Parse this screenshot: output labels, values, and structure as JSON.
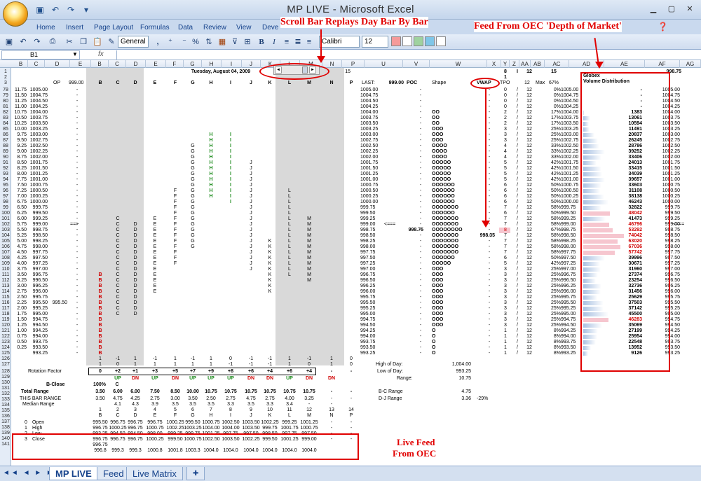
{
  "title": "MP LIVE - Microsoft Excel",
  "ribbon_tabs": [
    "Home",
    "Insert",
    "Page Layout",
    "Formulas",
    "Data",
    "Review",
    "View",
    "Deve"
  ],
  "font": {
    "style": "General",
    "face": "Calibri",
    "size": "12"
  },
  "namebox": "B1",
  "fx": "fx",
  "col_headers": [
    "B",
    "C",
    "D",
    "E",
    "B",
    "C",
    "D",
    "E",
    "F",
    "G",
    "H",
    "I",
    "J",
    "K",
    "L",
    "M",
    "N",
    "P",
    "U",
    "V",
    "W",
    "X",
    "Y",
    "Z",
    "AA",
    "AB",
    "AC",
    "AD",
    "AE",
    "AF",
    "AG"
  ],
  "header": {
    "r1_date": "Tuesday, August 04, 2009",
    "r1_15": "15",
    "r1_z": "8",
    "r1_aa": "I",
    "r1_ab": "12",
    "r1_ac": "15",
    "r1_af": "998.75",
    "r2_z": "1",
    "r3_op": "OP",
    "r3_999": "999.00",
    "r3_cols": [
      "B",
      "C",
      "D",
      "E",
      "F",
      "G",
      "H",
      "I",
      "J",
      "K",
      "L",
      "M",
      "N",
      "P"
    ],
    "r3_last": "LAST:",
    "r3_lastval": "999.00",
    "r3_poc": "POC",
    "r3_shape": "Shape",
    "r3_vwap": "VWAP",
    "r3_tpo": "TPO",
    "r3_12": "12",
    "r3_max": "Max",
    "r3_67": "67%",
    "ae_title1": "Globex",
    "ae_title2": "Volume Distribution"
  },
  "rows": [
    {
      "r": "78",
      "b": "11.75",
      "c": "1005.00",
      "u": "1005.00",
      "tpo": "0",
      "pct": "0%",
      "ad": "1005.00",
      "vol": "-",
      "af": "1005.00"
    },
    {
      "r": "79",
      "b": "11.50",
      "c": "1004.75",
      "u": "1004.75",
      "tpo": "0",
      "pct": "0%",
      "ad": "1004.75",
      "vol": "-",
      "af": "1004.75"
    },
    {
      "r": "80",
      "b": "11.25",
      "c": "1004.50",
      "u": "1004.50",
      "tpo": "0",
      "pct": "0%",
      "ad": "1004.50",
      "vol": "-",
      "af": "1004.50"
    },
    {
      "r": "81",
      "b": "11.00",
      "c": "1004.25",
      "u": "1004.25",
      "tpo": "0",
      "pct": "0%",
      "ad": "1004.25",
      "vol": "-",
      "af": "1004.25"
    },
    {
      "r": "82",
      "b": "10.75",
      "c": "1004.00",
      "u": "1004.00",
      "sh": "OO",
      "tpo": "2",
      "pct": "17%",
      "ad": "1004.00",
      "vol": "1383",
      "af": "1004.00"
    },
    {
      "r": "83",
      "b": "10.50",
      "c": "1003.75",
      "u": "1003.75",
      "sh": "OO",
      "tpo": "2",
      "pct": "17%",
      "ad": "1003.75",
      "vol": "13061",
      "af": "1003.75"
    },
    {
      "r": "84",
      "b": "10.25",
      "c": "1003.50",
      "u": "1003.50",
      "sh": "OO",
      "tpo": "2",
      "pct": "17%",
      "ad": "1003.50",
      "vol": "10594",
      "af": "1003.50"
    },
    {
      "r": "85",
      "b": "10.00",
      "c": "1003.25",
      "u": "1003.25",
      "sh": "OOO",
      "tpo": "3",
      "pct": "25%",
      "ad": "1003.25",
      "vol": "11491",
      "af": "1003.25"
    },
    {
      "r": "86",
      "b": "9.75",
      "c": "1003.00",
      "u": "1003.00",
      "sh": "OOO",
      "tpo": "3",
      "pct": "25%",
      "ad": "1003.00",
      "vol": "20837",
      "af": "1003.00"
    },
    {
      "r": "87",
      "b": "9.50",
      "c": "1002.75",
      "u": "1002.75",
      "sh": "OOO",
      "tpo": "3",
      "pct": "25%",
      "ad": "1002.75",
      "vol": "26245",
      "af": "1002.75"
    },
    {
      "r": "88",
      "b": "9.25",
      "c": "1002.50",
      "u": "1002.50",
      "sh": "OOOO",
      "tpo": "4",
      "pct": "33%",
      "ad": "1002.50",
      "vol": "28786",
      "af": "1002.50"
    },
    {
      "r": "89",
      "b": "9.00",
      "c": "1002.25",
      "u": "1002.25",
      "sh": "OOOO",
      "tpo": "4",
      "pct": "33%",
      "ad": "1002.25",
      "vol": "39252",
      "af": "1002.25"
    },
    {
      "r": "90",
      "b": "8.75",
      "c": "1002.00",
      "u": "1002.00",
      "sh": "OOOO",
      "tpo": "4",
      "pct": "33%",
      "ad": "1002.00",
      "vol": "33406",
      "af": "1002.00"
    },
    {
      "r": "91",
      "b": "8.50",
      "c": "1001.75",
      "u": "1001.75",
      "sh": "OOOOO",
      "tpo": "5",
      "pct": "42%",
      "ad": "1001.75",
      "vol": "24013",
      "af": "1001.75"
    },
    {
      "r": "92",
      "b": "8.25",
      "c": "1001.50",
      "u": "1001.50",
      "sh": "OOOOO",
      "tpo": "5",
      "pct": "42%",
      "ad": "1001.50",
      "vol": "33415",
      "af": "1001.50"
    },
    {
      "r": "93",
      "b": "8.00",
      "c": "1001.25",
      "u": "1001.25",
      "sh": "OOOOO",
      "tpo": "5",
      "pct": "42%",
      "ad": "1001.25",
      "vol": "34039",
      "af": "1001.25"
    },
    {
      "r": "94",
      "b": "7.75",
      "c": "1001.00",
      "u": "1001.00",
      "sh": "OOOOO",
      "tpo": "5",
      "pct": "42%",
      "ad": "1001.00",
      "vol": "39657",
      "af": "1001.00"
    },
    {
      "r": "95",
      "b": "7.50",
      "c": "1000.75",
      "u": "1000.75",
      "sh": "OOOOOO",
      "tpo": "6",
      "pct": "50%",
      "ad": "1000.75",
      "vol": "33603",
      "af": "1000.75"
    },
    {
      "r": "96",
      "b": "7.25",
      "c": "1000.50",
      "u": "1000.50",
      "sh": "OOOOOO",
      "tpo": "6",
      "pct": "50%",
      "ad": "1000.50",
      "vol": "31108",
      "af": "1000.50"
    },
    {
      "r": "97",
      "b": "7.00",
      "c": "1000.25",
      "u": "1000.25",
      "sh": "OOOOOO",
      "tpo": "6",
      "pct": "50%",
      "ad": "1000.25",
      "vol": "38138",
      "af": "1000.25"
    },
    {
      "r": "98",
      "b": "6.75",
      "c": "1000.00",
      "u": "1000.00",
      "sh": "OOOOOO",
      "tpo": "6",
      "pct": "50%",
      "ad": "1000.00",
      "vol": "46243",
      "af": "1000.00"
    },
    {
      "r": "99",
      "b": "6.50",
      "c": "999.75",
      "u": "999.75",
      "sh": "OOOOOOO",
      "tpo": "7",
      "pct": "58%",
      "ad": "999.75",
      "vol": "32822",
      "af": "999.75"
    },
    {
      "r": "100",
      "b": "6.25",
      "c": "999.50",
      "u": "999.50",
      "sh": "OOOOOO",
      "tpo": "6",
      "pct": "50%",
      "ad": "999.50",
      "vol": "48042",
      "af": "999.50",
      "hi": true
    },
    {
      "r": "101",
      "b": "6.00",
      "c": "999.25",
      "u": "999.25",
      "sh": "OOOOOOO",
      "tpo": "7",
      "pct": "58%",
      "ad": "999.25",
      "vol": "41473",
      "af": "999.25"
    },
    {
      "r": "102",
      "b": "5.75",
      "c": "999.00",
      "u": "999.00",
      "sh": "OOOOOOO",
      "tpo": "7",
      "pct": "58%",
      "ad": "999.00",
      "vol": "46796",
      "af": "999.00",
      "hi": true
    },
    {
      "r": "103",
      "b": "5.50",
      "c": "998.75",
      "u": "998.75",
      "sh": "OOOOOOOO",
      "tpo": "8",
      "pct": "67%",
      "ad": "998.75",
      "vol": "53292",
      "af": "998.75",
      "hi": true,
      "poc": true
    },
    {
      "r": "104",
      "b": "5.25",
      "c": "998.50",
      "u": "998.50",
      "sh": "OOOOOOO",
      "tpo": "7",
      "pct": "58%",
      "ad": "998.50",
      "vol": "74042",
      "af": "998.50",
      "hi": true
    },
    {
      "r": "105",
      "b": "5.00",
      "c": "998.25",
      "u": "998.25",
      "sh": "OOOOOOO",
      "tpo": "7",
      "pct": "58%",
      "ad": "998.25",
      "vol": "63020",
      "af": "998.25",
      "hi": true
    },
    {
      "r": "106",
      "b": "4.75",
      "c": "998.00",
      "u": "998.00",
      "sh": "OOOOOOO",
      "tpo": "7",
      "pct": "58%",
      "ad": "998.00",
      "vol": "67036",
      "af": "998.00",
      "hi": true
    },
    {
      "r": "107",
      "b": "4.50",
      "c": "997.75",
      "u": "997.75",
      "sh": "OOOOOOO",
      "tpo": "7",
      "pct": "58%",
      "ad": "997.75",
      "vol": "57742",
      "af": "997.75",
      "hi": true
    },
    {
      "r": "108",
      "b": "4.25",
      "c": "997.50",
      "u": "997.50",
      "sh": "OOOOOO",
      "tpo": "6",
      "pct": "50%",
      "ad": "997.50",
      "vol": "39996",
      "af": "997.50"
    },
    {
      "r": "109",
      "b": "4.00",
      "c": "997.25",
      "u": "997.25",
      "sh": "OOOOO",
      "tpo": "5",
      "pct": "42%",
      "ad": "997.25",
      "vol": "30671",
      "af": "997.25"
    },
    {
      "r": "110",
      "b": "3.75",
      "c": "997.00",
      "u": "997.00",
      "sh": "OOO",
      "tpo": "3",
      "pct": "25%",
      "ad": "997.00",
      "vol": "31960",
      "af": "997.00"
    },
    {
      "r": "111",
      "b": "3.50",
      "c": "996.75",
      "u": "996.75",
      "sh": "OOO",
      "tpo": "3",
      "pct": "25%",
      "ad": "996.75",
      "vol": "27374",
      "af": "996.75"
    },
    {
      "r": "112",
      "b": "3.25",
      "c": "996.50",
      "u": "996.50",
      "sh": "OOO",
      "tpo": "3",
      "pct": "25%",
      "ad": "996.50",
      "vol": "23254",
      "af": "996.50"
    },
    {
      "r": "113",
      "b": "3.00",
      "c": "996.25",
      "u": "996.25",
      "sh": "OOO",
      "tpo": "3",
      "pct": "25%",
      "ad": "996.25",
      "vol": "32736",
      "af": "996.25"
    },
    {
      "r": "114",
      "b": "2.75",
      "c": "996.00",
      "u": "996.00",
      "sh": "OOO",
      "tpo": "3",
      "pct": "25%",
      "ad": "996.00",
      "vol": "31456",
      "af": "996.00"
    },
    {
      "r": "115",
      "b": "2.50",
      "c": "995.75",
      "u": "995.75",
      "sh": "OOO",
      "tpo": "3",
      "pct": "25%",
      "ad": "995.75",
      "vol": "25629",
      "af": "995.75"
    },
    {
      "r": "116",
      "b": "2.25",
      "c": "995.50",
      "u": "995.50",
      "sh": "OOO",
      "tpo": "3",
      "pct": "25%",
      "ad": "995.50",
      "vol": "37503",
      "af": "995.50"
    },
    {
      "r": "117",
      "b": "2.00",
      "c": "995.25",
      "u": "995.25",
      "sh": "OOO",
      "tpo": "3",
      "pct": "25%",
      "ad": "995.25",
      "vol": "37142",
      "af": "995.25"
    },
    {
      "r": "118",
      "b": "1.75",
      "c": "995.00",
      "u": "995.00",
      "sh": "OOO",
      "tpo": "3",
      "pct": "25%",
      "ad": "995.00",
      "vol": "45500",
      "af": "995.00"
    },
    {
      "r": "119",
      "b": "1.50",
      "c": "994.75",
      "u": "994.75",
      "sh": "OOO",
      "tpo": "3",
      "pct": "25%",
      "ad": "994.75",
      "vol": "46283",
      "af": "994.75",
      "hi": true
    },
    {
      "r": "120",
      "b": "1.25",
      "c": "994.50",
      "u": "994.50",
      "sh": "OOO",
      "tpo": "3",
      "pct": "25%",
      "ad": "994.50",
      "vol": "35069",
      "af": "994.50"
    },
    {
      "r": "121",
      "b": "1.00",
      "c": "994.25",
      "u": "994.25",
      "sh": "O",
      "tpo": "1",
      "pct": "8%",
      "ad": "994.25",
      "vol": "27199",
      "af": "994.25"
    },
    {
      "r": "122",
      "b": "0.75",
      "c": "994.00",
      "u": "994.00",
      "sh": "O",
      "tpo": "1",
      "pct": "8%",
      "ad": "994.00",
      "vol": "25954",
      "af": "994.00"
    },
    {
      "r": "123",
      "b": "0.50",
      "c": "993.75",
      "u": "993.75",
      "sh": "O",
      "tpo": "1",
      "pct": "8%",
      "ad": "993.75",
      "vol": "22548",
      "af": "993.75"
    },
    {
      "r": "124",
      "b": "0.25",
      "c": "993.50",
      "u": "993.50",
      "sh": "O",
      "tpo": "1",
      "pct": "8%",
      "ad": "993.50",
      "vol": "13952",
      "af": "993.50"
    },
    {
      "r": "125",
      "b": "",
      "c": "993.25",
      "u": "993.25",
      "sh": "O",
      "tpo": "1",
      "pct": "8%",
      "ad": "993.25",
      "vol": "9126",
      "af": "993.25"
    }
  ],
  "marks": {
    "995.50_d": "995.50",
    "arrow_left": "==>",
    "arrow_mid": "<===",
    "arrow_right": "<===",
    "poc_val": "998.75",
    "vwap_val": "998.35"
  },
  "bottom": {
    "r126": [
      "1",
      "-1",
      "1",
      "-1",
      "1",
      "-1",
      "1",
      "0",
      "-1",
      "-1",
      "1",
      "-1",
      "1",
      "0"
    ],
    "r127": [
      "1",
      "0",
      "1",
      "1",
      "1",
      "1",
      "1",
      "-1",
      "-1",
      "-1",
      "1",
      "0",
      "1",
      "0"
    ],
    "rotation_label": "Rotation Factor",
    "rotation": [
      "0",
      "+2",
      "+1",
      "+3",
      "+5",
      "+7",
      "+9",
      "+8",
      "+6",
      "+4",
      "+6",
      "+4",
      "-",
      "-"
    ],
    "updn": [
      "UP",
      "DN",
      "UP",
      "DN",
      "UP",
      "UP",
      "UP",
      "DN",
      "DN",
      "UP",
      "DN",
      "DN"
    ],
    "bclose_label": "B-Close",
    "bclose": "100%",
    "bclose_c": "C",
    "total_label": "Total Range",
    "total": [
      "3.50",
      "6.00",
      "6.00",
      "7.50",
      "8.50",
      "10.00",
      "10.75",
      "10.75",
      "10.75",
      "10.75",
      "10.75",
      "10.75",
      "-",
      "-"
    ],
    "thisbar_label": "THIS BAR RANGE",
    "thisbar": [
      "3.50",
      "4.75",
      "4.25",
      "2.75",
      "3.00",
      "3.50",
      "2.50",
      "2.75",
      "4.75",
      "2.75",
      "4.00",
      "3.25",
      "-",
      "-"
    ],
    "median_label": "Median Range",
    "median": [
      "4.1",
      "4.3",
      "3.9",
      "3.5",
      "3.5",
      "3.5",
      "3.3",
      "3.5",
      "3.3",
      "3.4",
      "-",
      "-"
    ],
    "nums": [
      "1",
      "2",
      "3",
      "4",
      "5",
      "6",
      "7",
      "8",
      "9",
      "10",
      "11",
      "12",
      "13",
      "14"
    ],
    "letters": [
      "B",
      "C",
      "D",
      "E",
      "F",
      "G",
      "H",
      "I",
      "J",
      "K",
      "L",
      "M",
      "N",
      "P"
    ],
    "ohlc": [
      {
        "idx": "0",
        "name": "Open",
        "v": [
          "995.50",
          "996.75",
          "996.75",
          "996.75",
          "1000.25",
          "999.50",
          "1000.75",
          "1002.50",
          "1003.50",
          "1002.25",
          "999.25",
          "1001.25",
          "-",
          "-"
        ]
      },
      {
        "idx": "1",
        "name": "High",
        "v": [
          "996.75",
          "1000.25",
          "996.75",
          "1000.75",
          "1002.25",
          "1003.25",
          "1004.00",
          "1004.00",
          "1003.50",
          "999.75",
          "1001.75",
          "1000.75",
          "-",
          "-"
        ]
      },
      {
        "idx": "2",
        "name": "Low",
        "v": [
          "993.25",
          "994.50",
          "994.50",
          "998.00",
          "999.25",
          "999.75",
          "1001.25",
          "997.75",
          "997.50",
          "998.50",
          "997.75",
          "997.50",
          "-",
          "-"
        ]
      },
      {
        "idx": "3",
        "name": "Close",
        "v": [
          "996.75",
          "996.75",
          "996.75",
          "1000.25",
          "999.50",
          "1000.75",
          "1002.50",
          "1003.50",
          "1002.25",
          "999.50",
          "1001.25",
          "999.00",
          "-",
          "-"
        ]
      }
    ],
    "r140": "996.75",
    "r141": [
      "996.8",
      "999.3",
      "999.3",
      "1000.8",
      "1001.8",
      "1003.3",
      "1004.0",
      "1004.0",
      "1004.0",
      "1004.0",
      "1004.0",
      "1004.0"
    ],
    "high_label": "High of Day:",
    "high": "1,004.00",
    "low_label": "Low of Day:",
    "low": "993.25",
    "range_label": "Range:",
    "range": "10.75",
    "bc_label": "B-C Range",
    "bc": "4.75",
    "dj_label": "D-J Range",
    "dj": "3.36",
    "dj_pct": "-29%"
  },
  "sheets": [
    "MP LIVE",
    "Feed",
    "Live Matrix"
  ],
  "annotations": {
    "scroll": "Scroll Bar Replays Day Bar By Bar",
    "feed": "Feed From OEC 'Depth of Market'",
    "live1": "Live Feed",
    "live2": "From OEC"
  },
  "colors": {
    "accent": "#e00000",
    "green": "#1b8a1b",
    "shade": "#d9d9d9"
  }
}
